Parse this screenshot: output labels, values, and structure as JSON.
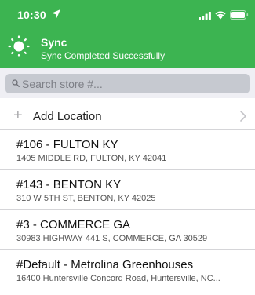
{
  "status_bar": {
    "time": "10:30",
    "icons": [
      "location-arrow-icon",
      "cellular-signal-icon",
      "wifi-icon",
      "battery-icon"
    ]
  },
  "sync": {
    "icon": "sun-icon",
    "title": "Sync",
    "subtitle": "Sync Completed Successfully",
    "header_color": "#3cb451"
  },
  "search": {
    "placeholder": "Search store #...",
    "value": ""
  },
  "add_location": {
    "label": "Add Location"
  },
  "stores": [
    {
      "name": "#106 - FULTON KY",
      "address": "1405 MIDDLE RD, FULTON, KY 42041"
    },
    {
      "name": "#143 - BENTON KY",
      "address": "310 W 5TH ST, BENTON, KY 42025"
    },
    {
      "name": "#3 - COMMERCE GA",
      "address": "30983 HIGHWAY 441 S, COMMERCE, GA 30529"
    },
    {
      "name": "#Default - Metrolina Greenhouses",
      "address": "16400 Huntersville Concord Road, Huntersville, NC..."
    }
  ]
}
